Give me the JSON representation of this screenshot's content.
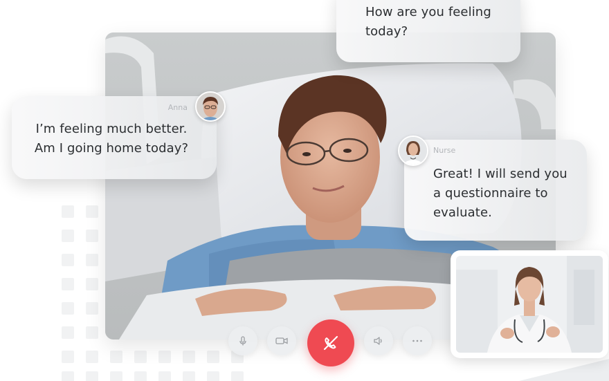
{
  "messages": {
    "top": {
      "text_line1": "How are you feeling",
      "text_line2": "today?"
    },
    "anna": {
      "sender": "Anna",
      "text_line1": "I’m feeling much better.",
      "text_line2": "Am I going home today?"
    },
    "nurse": {
      "sender": "Nurse",
      "text_line1": "Great! I will send you",
      "text_line2": "a questionnaire to",
      "text_line3": "evaluate."
    }
  },
  "controls": {
    "icons": [
      "microphone-icon",
      "video-camera-icon",
      "end-call-icon",
      "speaker-icon",
      "more-icon"
    ]
  },
  "colors": {
    "end_call": "#ef4a52",
    "text": "#2b2e31",
    "sender_label": "#b3b6ba"
  }
}
